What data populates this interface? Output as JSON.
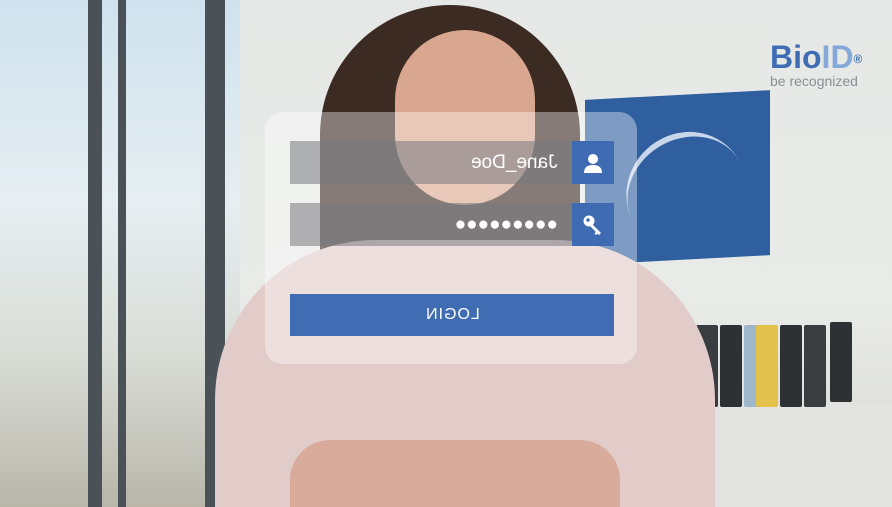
{
  "brand": {
    "name_main": "Bio",
    "name_accent": "ID",
    "registered_mark": "®",
    "tagline": "be recognized"
  },
  "login_form": {
    "username_value": "Jane_Doe",
    "password_mask": "●●●●●●●●●",
    "login_label": "LOGIN",
    "user_icon": "user-icon",
    "key_icon": "key-icon"
  },
  "colors": {
    "accent_blue": "#3f6cb3",
    "password_dots": "#ff0a0a",
    "brand_light_blue": "#86a8d8",
    "tagline_gray": "#8a8f96"
  }
}
